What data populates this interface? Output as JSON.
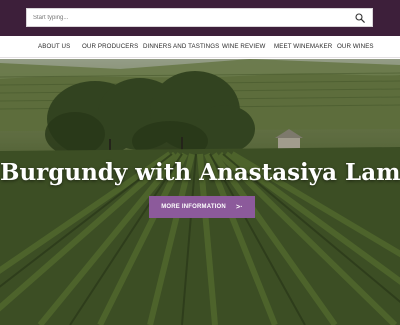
{
  "search": {
    "placeholder": "Start typing...",
    "icon": "search-icon"
  },
  "nav": {
    "items": [
      {
        "label": "ABOUT US"
      },
      {
        "label": "OUR PRODUCERS"
      },
      {
        "label": "DINNERS AND TASTINGS"
      },
      {
        "label": "WINE REVIEW"
      },
      {
        "label": "MEET WINEMAKER"
      },
      {
        "label": "OUR WINES"
      }
    ]
  },
  "hero": {
    "title": "Burgundy with Anastasiya Lamb",
    "button_label": "MORE INFORMATION",
    "button_arrow": ">·",
    "button_color": "#8c5a9b"
  },
  "colors": {
    "topbar": "#3d1f3a"
  }
}
